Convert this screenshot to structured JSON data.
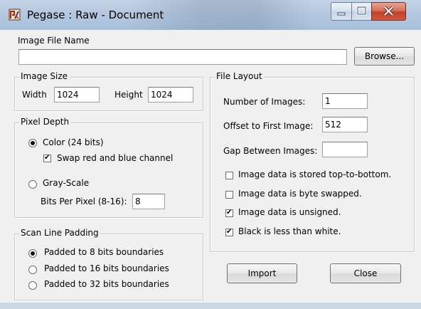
{
  "window": {
    "title": "Pegase : Raw - Document",
    "icons": {
      "app": "pegase-app-icon",
      "minimize": "minimize-icon",
      "maximize": "maximize-icon",
      "close": "close-x-icon"
    }
  },
  "image_file": {
    "label": "Image File Name",
    "value": "",
    "browse_label": "Browse..."
  },
  "image_size": {
    "title": "Image Size",
    "width_label": "Width",
    "width_value": "1024",
    "height_label": "Height",
    "height_value": "1024"
  },
  "pixel_depth": {
    "title": "Pixel Depth",
    "color_label": "Color (24 bits)",
    "color_selected": true,
    "swap_label": "Swap red and blue channel",
    "swap_checked": true,
    "gray_label": "Gray-Scale",
    "gray_selected": false,
    "bpp_label": "Bits Per Pixel (8-16):",
    "bpp_value": "8"
  },
  "scan_line": {
    "title": "Scan Line Padding",
    "options": [
      {
        "label": "Padded to 8 bits boundaries",
        "selected": true
      },
      {
        "label": "Padded to 16 bits boundaries",
        "selected": false
      },
      {
        "label": "Padded to 32 bits boundaries",
        "selected": false
      }
    ]
  },
  "file_layout": {
    "title": "File Layout",
    "num_images_label": "Number of Images:",
    "num_images_value": "1",
    "offset_label": "Offset to First Image:",
    "offset_value": "512",
    "gap_label": "Gap Between Images:",
    "gap_value": "",
    "checks": [
      {
        "label": "Image data is stored top-to-bottom.",
        "checked": false
      },
      {
        "label": "Image data is byte swapped.",
        "checked": false
      },
      {
        "label": "Image data is unsigned.",
        "checked": true
      },
      {
        "label": "Black is less than white.",
        "checked": true
      }
    ]
  },
  "actions": {
    "import_label": "Import",
    "close_label": "Close"
  }
}
